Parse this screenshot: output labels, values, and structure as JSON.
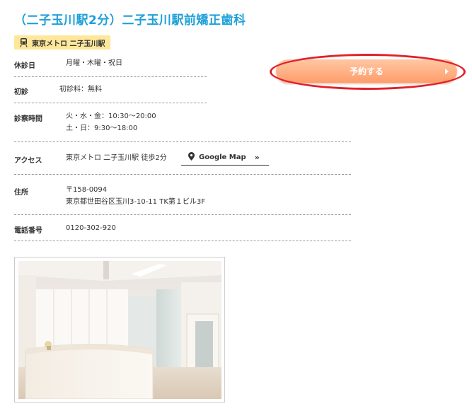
{
  "clinic": {
    "title": "（二子玉川駅2分）二子玉川駅前矯正歯科",
    "station_badge": "東京メトロ 二子玉川駅"
  },
  "reserve": {
    "label": "予約する",
    "arrow_icon": "triangle-right-icon"
  },
  "info": {
    "closed": {
      "label": "休診日",
      "value": "月曜・木曜・祝日"
    },
    "first_visit": {
      "label": "初診",
      "value": "初診料：無料"
    },
    "hours": {
      "label": "診察時間",
      "line1": "火・水・金：10:30〜20:00",
      "line2": "土・日：9:30〜18:00"
    },
    "access": {
      "label": "アクセス",
      "value": "東京メトロ 二子玉川駅 徒歩2分",
      "map_label": "Google Map",
      "map_arrow": "»"
    },
    "address": {
      "label": "住所",
      "line1": "〒158-0094",
      "line2": "東京都世田谷区玉川3-10-11 TK第１ビル3F"
    },
    "phone": {
      "label": "電話番号",
      "value": "0120-302-920"
    }
  },
  "colors": {
    "title": "#1ea0d8",
    "badge_bg": "#ffe79a",
    "reserve": "#ffab7a",
    "highlight": "#e0212b"
  }
}
